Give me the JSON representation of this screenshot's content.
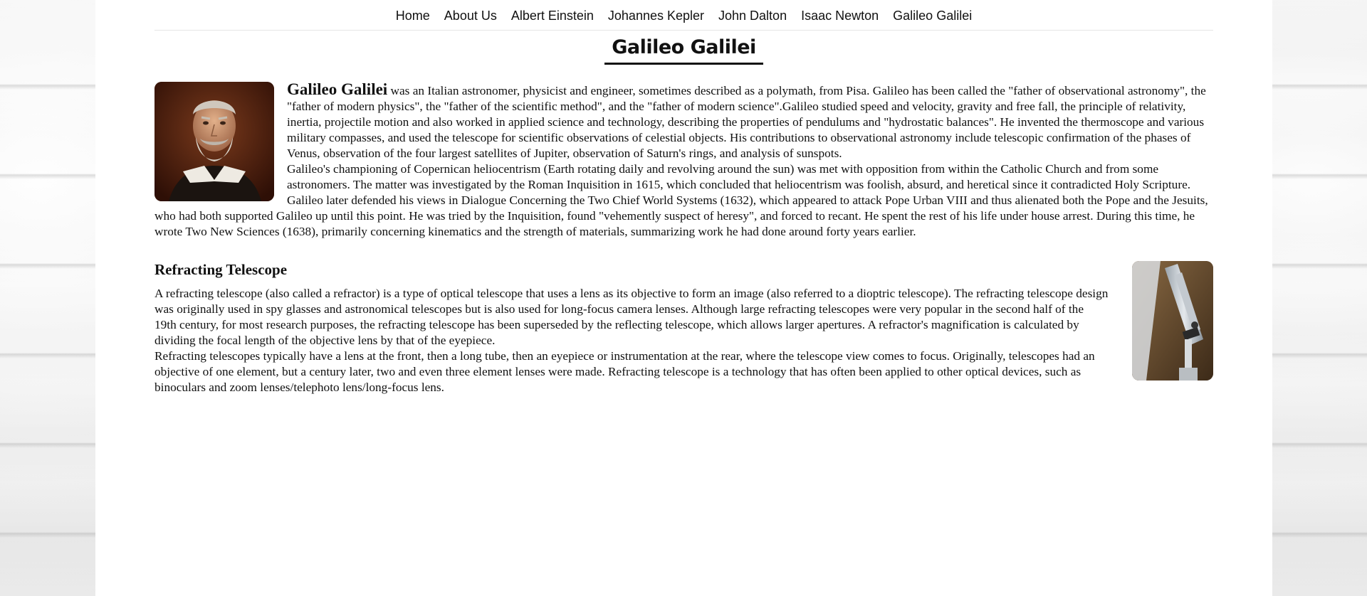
{
  "nav": {
    "items": [
      {
        "label": "Home"
      },
      {
        "label": "About Us"
      },
      {
        "label": "Albert Einstein"
      },
      {
        "label": "Johannes Kepler"
      },
      {
        "label": "John Dalton"
      },
      {
        "label": "Isaac Newton"
      },
      {
        "label": "Galileo Galilei"
      }
    ]
  },
  "page_title": "Galileo Galilei",
  "bio": {
    "name": "Galileo Galilei",
    "intro": " was an Italian astronomer, physicist and engineer, sometimes described as a polymath, from Pisa. Galileo has been called the \"father of observational astronomy\", the \"father of modern physics\", the \"father of the scientific method\", and the \"father of modern science\".Galileo studied speed and velocity, gravity and free fall, the principle of relativity, inertia, projectile motion and also worked in applied science and technology, describing the properties of pendulums and \"hydrostatic balances\". He invented the thermoscope and various military compasses, and used the telescope for scientific observations of celestial objects. His contributions to observational astronomy include telescopic confirmation of the phases of Venus, observation of the four largest satellites of Jupiter, observation of Saturn's rings, and analysis of sunspots.",
    "para2": "Galileo's championing of Copernican heliocentrism (Earth rotating daily and revolving around the sun) was met with opposition from within the Catholic Church and from some astronomers. The matter was investigated by the Roman Inquisition in 1615, which concluded that heliocentrism was foolish, absurd, and heretical since it contradicted Holy Scripture.",
    "para3": "Galileo later defended his views in Dialogue Concerning the Two Chief World Systems (1632), which appeared to attack Pope Urban VIII and thus alienated both the Pope and the Jesuits, who had both supported Galileo up until this point. He was tried by the Inquisition, found \"vehemently suspect of heresy\", and forced to recant. He spent the rest of his life under house arrest. During this time, he wrote Two New Sciences (1638), primarily concerning kinematics and the strength of materials, summarizing work he had done around forty years earlier."
  },
  "telescope": {
    "heading": "Refracting Telescope",
    "para1": "A refracting telescope (also called a refractor) is a type of optical telescope that uses a lens as its objective to form an image (also referred to a dioptric telescope). The refracting telescope design was originally used in spy glasses and astronomical telescopes but is also used for long-focus camera lenses. Although large refracting telescopes were very popular in the second half of the 19th century, for most research purposes, the refracting telescope has been superseded by the reflecting telescope, which allows larger apertures. A refractor's magnification is calculated by dividing the focal length of the objective lens by that of the eyepiece.",
    "para2": "Refracting telescopes typically have a lens at the front, then a long tube, then an eyepiece or instrumentation at the rear, where the telescope view comes to focus. Originally, telescopes had an objective of one element, but a century later, two and even three element lenses were made. Refracting telescope is a technology that has often been applied to other optical devices, such as binoculars and zoom lenses/telephoto lens/long-focus lens."
  }
}
